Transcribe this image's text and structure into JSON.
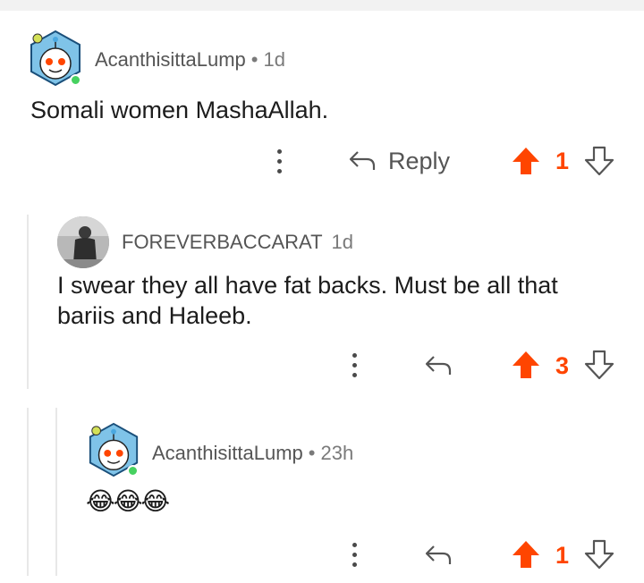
{
  "colors": {
    "upvote": "#ff4500",
    "text": "#1c1c1c",
    "meta": "#7a7a7a",
    "online": "#46d160"
  },
  "comments": [
    {
      "username": "AcanthisittaLump",
      "separator": "•",
      "time": "1d",
      "body": "Somali women MashaAllah.",
      "reply_label": "Reply",
      "score": "1",
      "avatar_icon": "snoo-avatar-icon"
    },
    {
      "username": "FOREVERBACCARAT",
      "time": "1d",
      "body": "I swear they all have fat backs. Must be all that bariis and Haleeb.",
      "score": "3",
      "avatar_icon": "photo-avatar-icon"
    },
    {
      "username": "AcanthisittaLump",
      "separator": "•",
      "time": "23h",
      "body": "😂😂😂",
      "score": "1",
      "avatar_icon": "snoo-avatar-icon"
    }
  ]
}
